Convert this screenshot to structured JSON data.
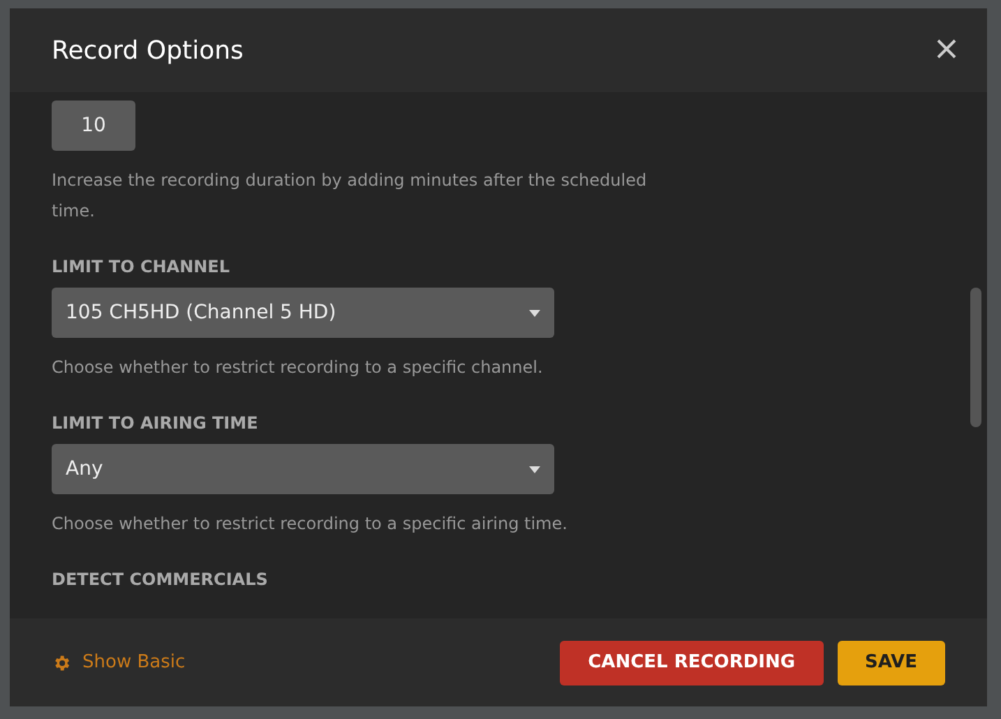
{
  "dialog": {
    "title": "Record Options"
  },
  "sections": [
    {
      "kind": "number",
      "value": "10",
      "help": "Increase the recording duration by adding minutes after the scheduled time."
    },
    {
      "kind": "select",
      "label": "LIMIT TO CHANNEL",
      "value": "105 CH5HD (Channel 5 HD)",
      "help": "Choose whether to restrict recording to a specific channel."
    },
    {
      "kind": "select",
      "label": "LIMIT TO AIRING TIME",
      "value": "Any",
      "help": "Choose whether to restrict recording to a specific airing time."
    },
    {
      "kind": "heading",
      "label": "DETECT COMMERCIALS"
    }
  ],
  "footer": {
    "toggle": "Show Basic",
    "buttons": [
      {
        "kind": "danger",
        "label": "CANCEL RECORDING"
      },
      {
        "kind": "primary",
        "label": "SAVE"
      }
    ]
  }
}
